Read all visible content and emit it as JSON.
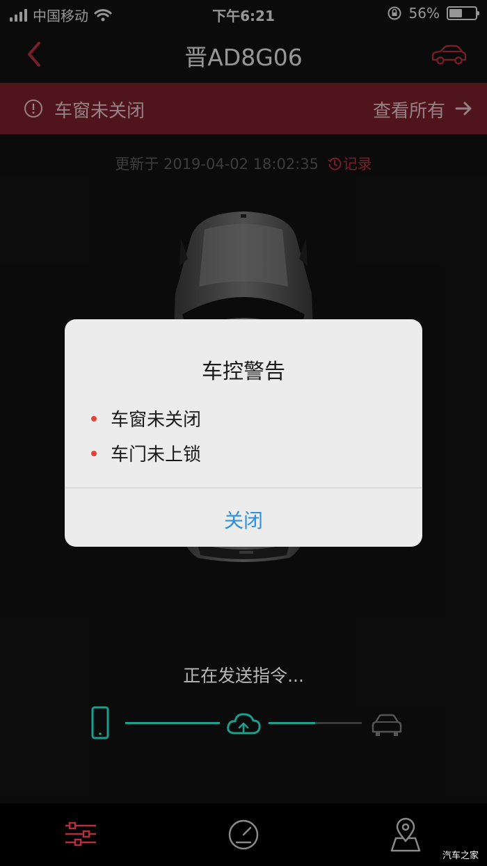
{
  "status_bar": {
    "carrier": "中国移动",
    "time": "下午6:21",
    "battery": "56%",
    "battery_level": 0.56
  },
  "nav": {
    "title": "晋AD8G06"
  },
  "alert_bar": {
    "message": "车窗未关闭",
    "view_all": "查看所有"
  },
  "update": {
    "prefix": "更新于",
    "timestamp": "2019-04-02 18:02:35",
    "record_label": "记录"
  },
  "dialog": {
    "title": "车控警告",
    "items": [
      "车窗未关闭",
      "车门未上锁"
    ],
    "close_label": "关闭"
  },
  "command": {
    "status_text": "正在发送指令...",
    "stages": [
      "phone-icon",
      "cloud-upload-icon",
      "car-icon"
    ],
    "link_progress": [
      1.0,
      0.5
    ]
  },
  "tab_bar": {
    "items": [
      "controls-sliders-icon",
      "dashboard-gauge-icon",
      "map-location-icon"
    ],
    "active_index": 0
  },
  "watermark": "汽车之家",
  "colors": {
    "accent_red": "#b3303f",
    "alert_bg": "#7a1f2b",
    "teal": "#1aa08d",
    "link_blue": "#2c8fe0"
  }
}
